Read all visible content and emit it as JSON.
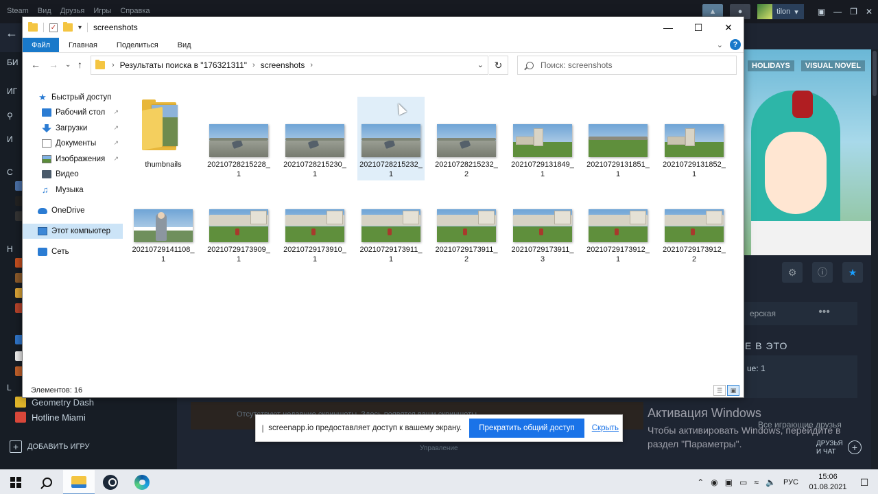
{
  "steam": {
    "menu": [
      "Steam",
      "Вид",
      "Друзья",
      "Игры",
      "Справка"
    ],
    "username": "tilon",
    "left_sections": [
      "БИ",
      "ИГ",
      "И",
      "С",
      "Н",
      "L"
    ],
    "games": [
      "Geometry Dash",
      "Hotline Miami"
    ],
    "add_game": "ДОБАВИТЬ ИГРУ",
    "hero_tags": [
      "HOLIDAYS",
      "VISUAL NOVEL"
    ],
    "community_partial": "ерская",
    "play_heading_partial": "Е В ЭТО",
    "friend_box_partial": "ue: 1",
    "all_friends": "Все играющие друзья",
    "manage": "Управление",
    "no_screenshots_partial": "Отсутствуют недавние скриншоты. Здесь появятся ваши скриншоты",
    "friends_chat": [
      "ДРУЗЬЯ",
      "И ЧАТ"
    ]
  },
  "windows_activation": {
    "title": "Активация Windows",
    "line1": "Чтобы активировать Windows, перейдите в",
    "line2": "раздел \"Параметры\"."
  },
  "explorer": {
    "title": "screenshots",
    "ribbon_tabs": [
      "Файл",
      "Главная",
      "Поделиться",
      "Вид"
    ],
    "breadcrumb": [
      "Результаты поиска в \"176321311\"",
      "screenshots"
    ],
    "search_placeholder": "Поиск: screenshots",
    "sidebar": [
      {
        "label": "Быстрый доступ",
        "icon": "star-icon"
      },
      {
        "label": "Рабочий стол",
        "icon": "desktop-icon",
        "pinned": true
      },
      {
        "label": "Загрузки",
        "icon": "download-icon",
        "pinned": true
      },
      {
        "label": "Документы",
        "icon": "documents-icon",
        "pinned": true
      },
      {
        "label": "Изображения",
        "icon": "pictures-icon",
        "pinned": true
      },
      {
        "label": "Видео",
        "icon": "video-icon"
      },
      {
        "label": "Музыка",
        "icon": "music-icon"
      },
      {
        "label": "OneDrive",
        "icon": "cloud-icon"
      },
      {
        "label": "Этот компьютер",
        "icon": "computer-icon",
        "selected": true
      },
      {
        "label": "Сеть",
        "icon": "network-icon"
      }
    ],
    "items": [
      {
        "name": "thumbnails",
        "type": "folder"
      },
      {
        "name": "20210728215228_1",
        "type": "image",
        "scene": "road"
      },
      {
        "name": "20210728215230_1",
        "type": "image",
        "scene": "road"
      },
      {
        "name": "20210728215232_1",
        "type": "image",
        "scene": "road",
        "selected": true
      },
      {
        "name": "20210728215232_2",
        "type": "image",
        "scene": "road"
      },
      {
        "name": "20210729131849_1",
        "type": "image",
        "scene": "building"
      },
      {
        "name": "20210729131851_1",
        "type": "image",
        "scene": "field"
      },
      {
        "name": "20210729131852_1",
        "type": "image",
        "scene": "building"
      },
      {
        "name": "20210729141108_1",
        "type": "image",
        "scene": "character"
      },
      {
        "name": "20210729173909_1",
        "type": "image",
        "scene": "wall"
      },
      {
        "name": "20210729173910_1",
        "type": "image",
        "scene": "wall"
      },
      {
        "name": "20210729173911_1",
        "type": "image",
        "scene": "wall"
      },
      {
        "name": "20210729173911_2",
        "type": "image",
        "scene": "wall"
      },
      {
        "name": "20210729173911_3",
        "type": "image",
        "scene": "wall"
      },
      {
        "name": "20210729173912_1",
        "type": "image",
        "scene": "wall"
      },
      {
        "name": "20210729173912_2",
        "type": "image",
        "scene": "wall"
      }
    ],
    "status_count": "Элементов: 16"
  },
  "share_bar": {
    "message": "screenapp.io предоставляет доступ к вашему экрану.",
    "stop_label": "Прекратить общий доступ",
    "hide_label": "Скрыть"
  },
  "taskbar": {
    "language": "РУС",
    "time": "15:06",
    "date": "01.08.2021"
  },
  "colors": {
    "file_tab": "#1979ca",
    "share_button": "#1a73e8",
    "selection": "#cce4f7"
  }
}
